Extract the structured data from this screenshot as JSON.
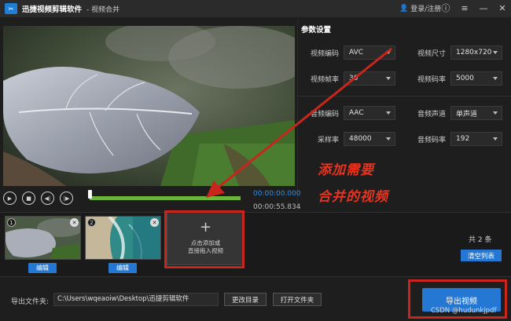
{
  "titlebar": {
    "app_name": "迅捷视频剪辑软件",
    "subtitle": "- 视频合并",
    "login": "登录/注册",
    "logo_glyph": "✂"
  },
  "params": {
    "title": "参数设置",
    "video_codec_label": "视频编码",
    "video_codec_value": "AVC",
    "video_size_label": "视频尺寸",
    "video_size_value": "1280x720",
    "frame_rate_label": "视频帧率",
    "frame_rate_value": "30",
    "video_bitrate_label": "视频码率",
    "video_bitrate_value": "5000",
    "audio_codec_label": "音频编码",
    "audio_codec_value": "AAC",
    "audio_channel_label": "音频声道",
    "audio_channel_value": "单声道",
    "sample_rate_label": "采样率",
    "sample_rate_value": "48000",
    "audio_bitrate_label": "音频码率",
    "audio_bitrate_value": "192"
  },
  "player": {
    "current_time": "00:00:00.000",
    "total_time": "00:00:55.834"
  },
  "clips": {
    "items": [
      {
        "num": "1",
        "edit_label": "编辑"
      },
      {
        "num": "2",
        "edit_label": "编辑"
      }
    ],
    "add_line1": "点击添加或",
    "add_line2": "直接拖入视频",
    "count": "共 2 条",
    "clear_label": "清空列表"
  },
  "output": {
    "label": "导出文件夹:",
    "path": "C:\\Users\\wqeaoiw\\Desktop\\迅捷剪辑软件",
    "change_dir": "更改目录",
    "open_dir": "打开文件夹",
    "export": "导出视频"
  },
  "annotation": {
    "line1": "添加需要",
    "line2": "合并的视频",
    "color": "#c8261c"
  },
  "watermark": "CSDN @hudunkjpdf",
  "colors": {
    "accent": "#2478d4",
    "timeline": "#6db43a",
    "time_blue": "#2e8fe6"
  }
}
